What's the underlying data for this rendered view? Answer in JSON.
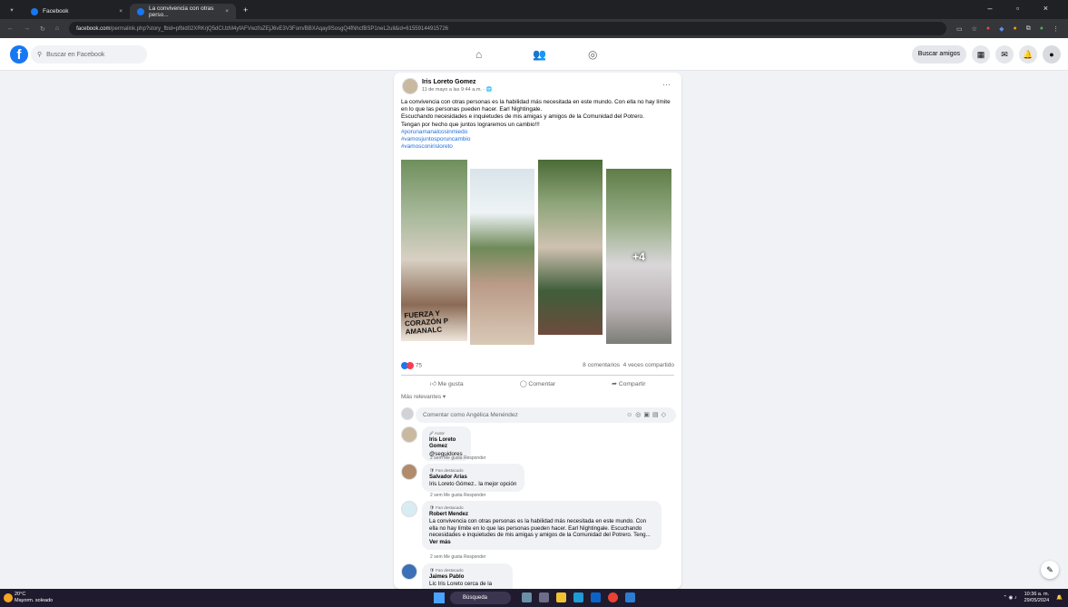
{
  "browser": {
    "tabs": [
      {
        "title": "Facebook"
      },
      {
        "title": "La convivencia con otras perso..."
      }
    ],
    "new_tab": "+",
    "url_domain": "facebook.com",
    "url_path": "/permalink.php?story_fbid=pfbid02XRKrjQ5dCUzM4yfAFVwzfoZEjJ6vE3V3Fom/BBXAqay9SosgQ4fNhcfBSP1neL2ull&id=61559144915726"
  },
  "facebook": {
    "logo": "f",
    "search_placeholder": "Buscar en Facebook",
    "find_friends": "Buscar amigos"
  },
  "post": {
    "author": "Iris Loreto Gomez",
    "meta": "11 de mayo a las 9:44 a.m. · 🌐",
    "text_lines": [
      "La convivencia con otras personas es la habilidad más necesitada en este mundo. Con ella no hay límite en lo que las personas pueden hacer. Earl Nightingale.",
      "Escuchando necesidades e inquietudes de  mis amigas y amigos de la Comunidad del Potrero.",
      "Tengan por hecho que juntos lograremos un cambio!!!"
    ],
    "hashtags": [
      "#porunamanalcosinmiedo",
      "#vamosjuntosporuncambio",
      "#vamosconirisloreto"
    ],
    "photo_overlay": "+4",
    "photo_caption": "FUERZA Y CORAZÓN P AMANALC",
    "reactions_count": "75",
    "comments_count": "8 comentarios",
    "shares_count": "4 veces compartido",
    "actions": {
      "like": "Me gusta",
      "comment": "Comentar",
      "share": "Compartir"
    },
    "sort_label": "Más relevantes ▾",
    "comment_placeholder": "Comentar como Angélica Menéndez"
  },
  "comments": [
    {
      "label": "🖉 Autor",
      "name": "Iris Loreto Gomez",
      "text": "@seguidores",
      "meta": "2 sem   Me gusta   Responder"
    },
    {
      "label": "🛡 Fan destacado",
      "name": "Salvador Arias",
      "text": "Iris Loreto Gómez.. la mejor opción",
      "meta": "2 sem   Me gusta   Responder"
    },
    {
      "label": "🛡 Fan destacado",
      "name": "Robert Mendez",
      "text": "La convivencia con otras personas es la habilidad más necesitada en este mundo. Con ella no hay límite en lo que las personas pueden hacer. Earl Nightingale. Escuchando necesidades e inquietudes de mis amigas y amigos de la Comunidad del Potrero. Teng...",
      "see_more": "Ver más",
      "meta": "2 sem   Me gusta   Responder"
    },
    {
      "label": "🛡 Fan destacado",
      "name": "Jaimes Pablo",
      "text": "Lic Iris Loreto cerca de la gente"
    }
  ],
  "taskbar": {
    "temp": "20°C",
    "weather": "Mayorm. soleado",
    "search": "Búsqueda",
    "time": "10:36 a. m.",
    "date": "29/05/2024"
  },
  "colors": {
    "brand": "#1877f2",
    "link": "#216fdb",
    "bg": "#f0f2f5"
  }
}
